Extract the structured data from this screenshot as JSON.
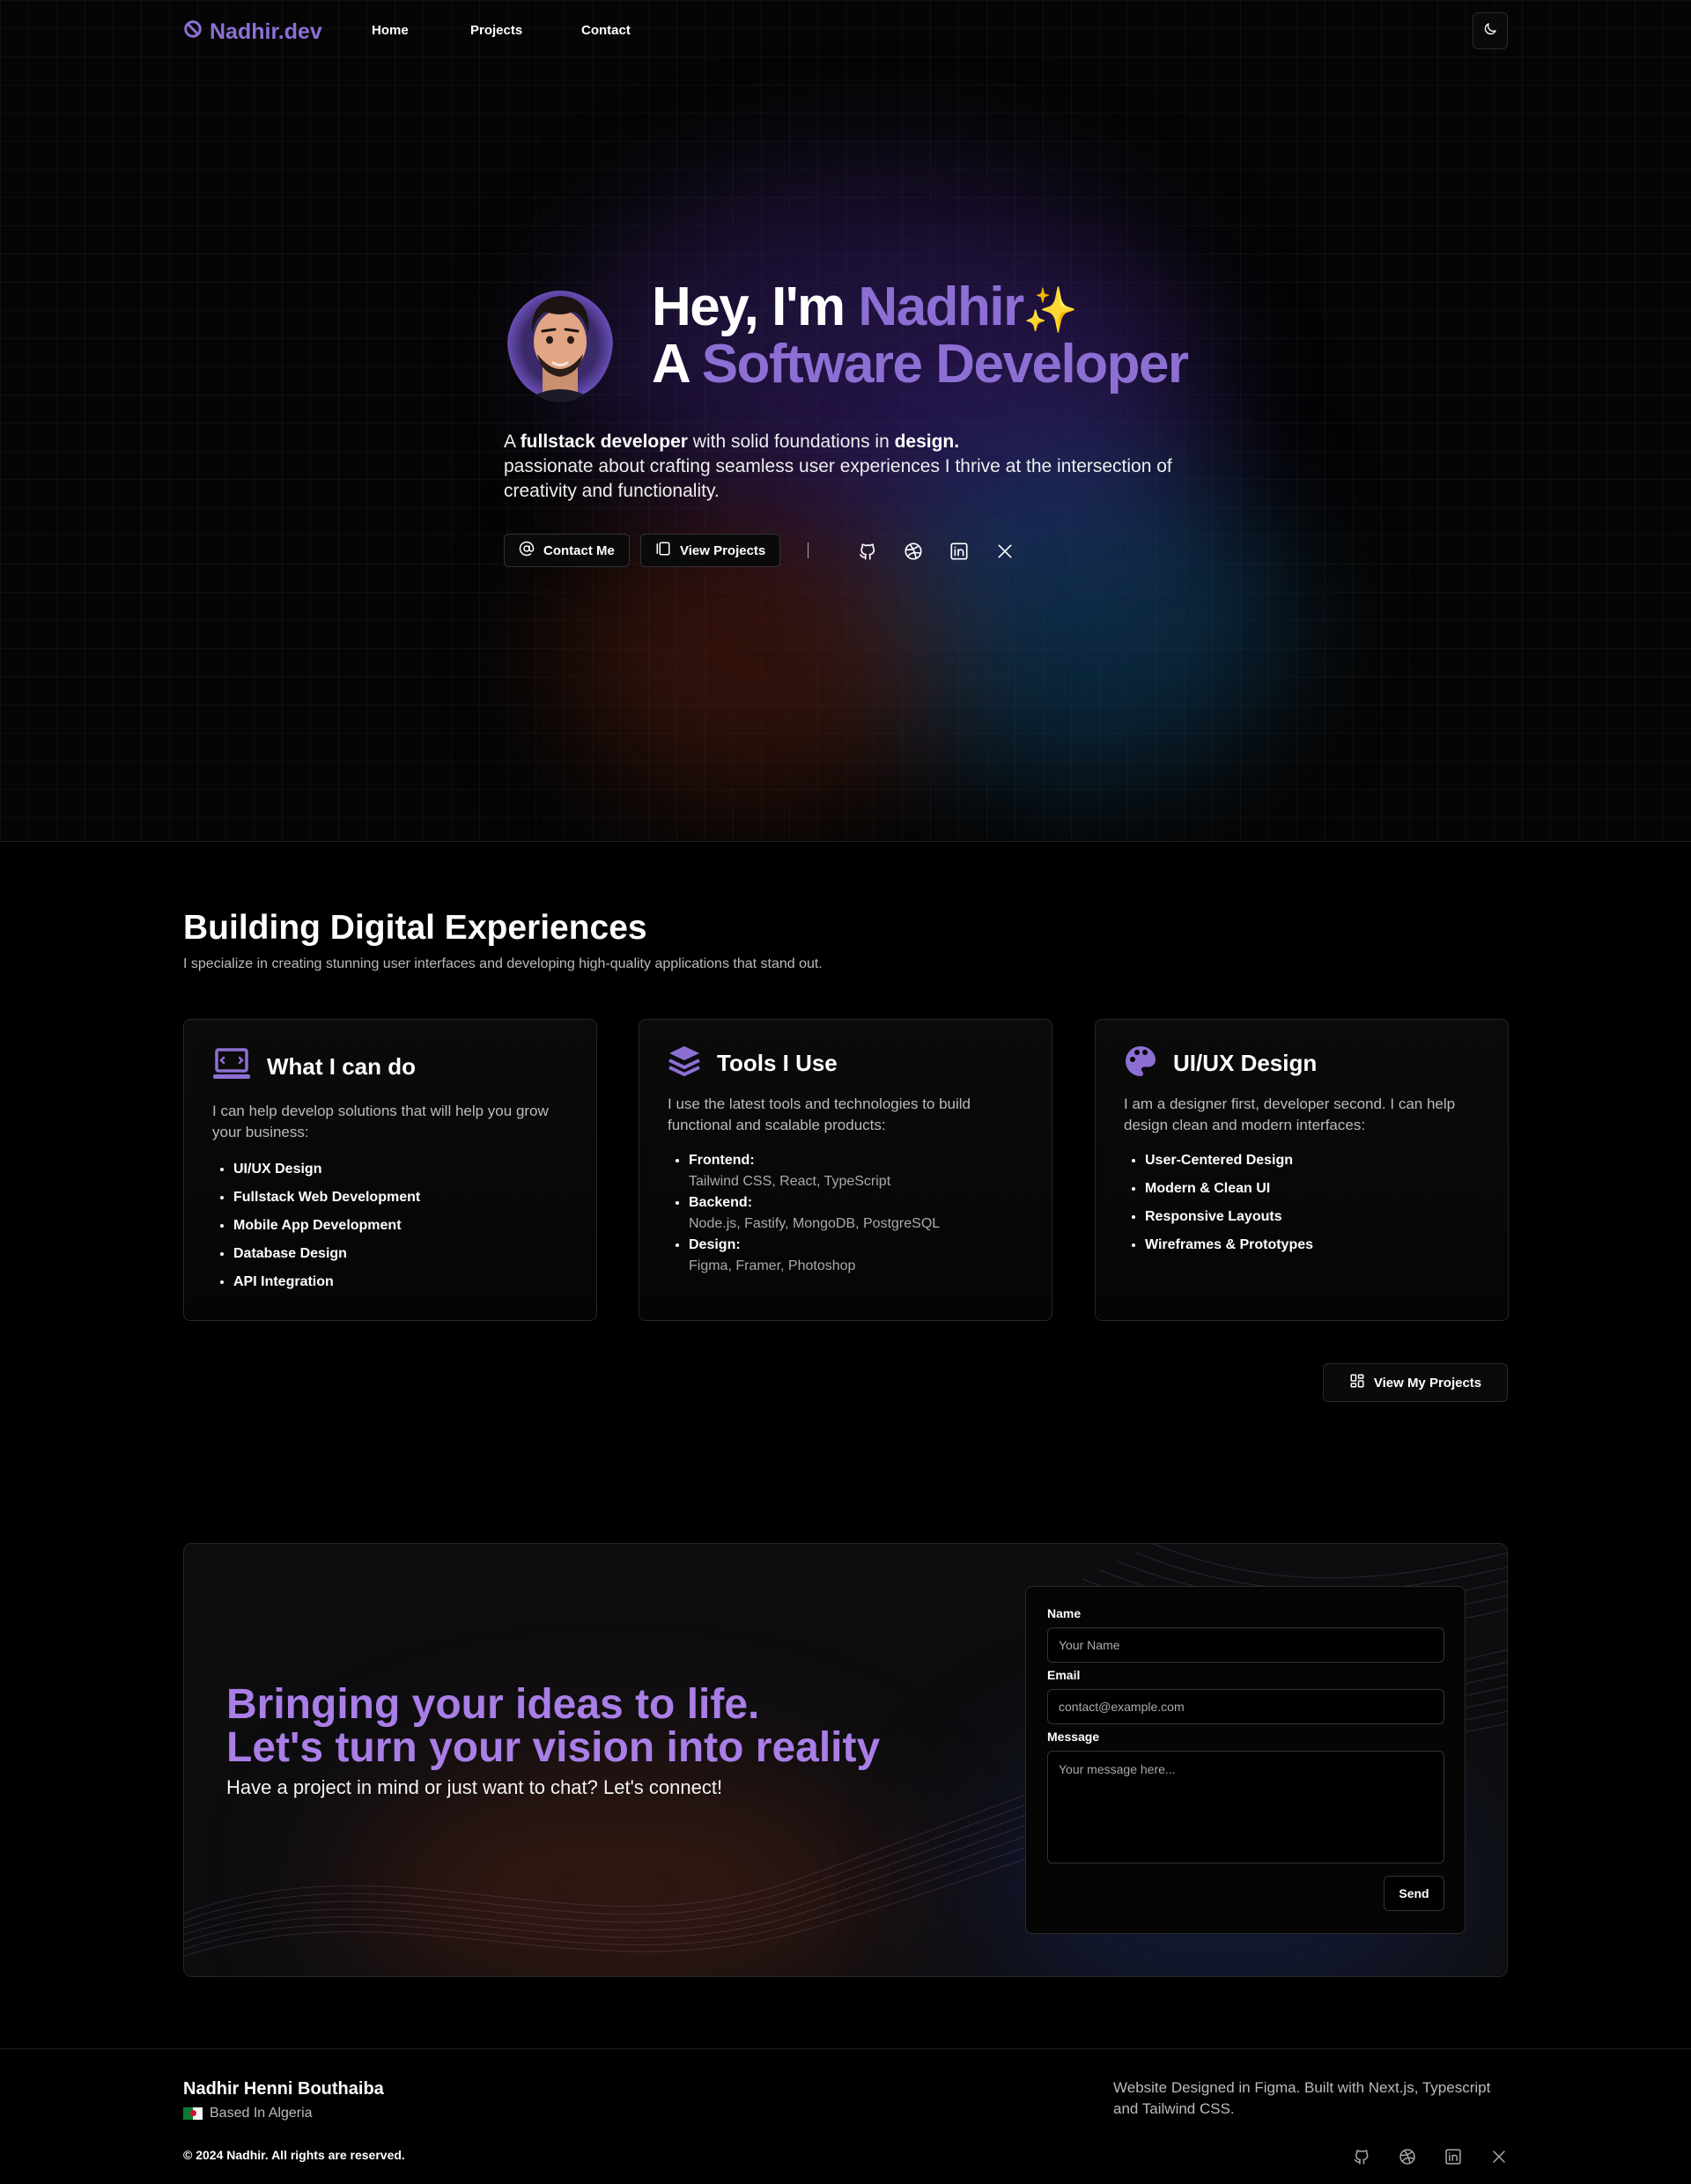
{
  "nav": {
    "logo": "Nadhir.dev",
    "home": "Home",
    "projects": "Projects",
    "contact": "Contact"
  },
  "hero": {
    "greeting_prefix": "Hey, I'm ",
    "name": "Nadhir",
    "sparkle": "✨",
    "role_prefix": "A ",
    "role": "Software Developer",
    "lead_a": "A ",
    "lead_fullstack": "fullstack developer",
    "lead_b": " with solid foundations in ",
    "lead_design": "design.",
    "lead_c": "passionate about crafting seamless user experiences I thrive at the intersection of creativity and functionality.",
    "contact_btn": "Contact Me",
    "projects_btn": "View Projects"
  },
  "about": {
    "title": "Building Digital Experiences",
    "subtitle": "I specialize in creating stunning user interfaces and developing high-quality applications that stand out.",
    "cards": [
      {
        "title": "What I can do",
        "icon": "laptop-icon",
        "desc": "I can help develop solutions that will help you grow your business:",
        "items": [
          "UI/UX Design",
          "Fullstack Web Development",
          "Mobile App Development",
          "Database Design",
          "API Integration"
        ]
      },
      {
        "title": "Tools I Use",
        "icon": "layers-icon",
        "desc": "I use the latest tools and technologies to build functional and scalable products:",
        "tools": [
          {
            "label": "Frontend:",
            "value": "Tailwind CSS, React, TypeScript"
          },
          {
            "label": "Backend:",
            "value": "Node.js, Fastify, MongoDB, PostgreSQL"
          },
          {
            "label": "Design:",
            "value": "Figma, Framer, Photoshop"
          }
        ]
      },
      {
        "title": "UI/UX Design",
        "icon": "palette-icon",
        "desc": "I am a designer first, developer second. I can help design clean and modern interfaces:",
        "items": [
          "User-Centered Design",
          "Modern & Clean UI",
          "Responsive Layouts",
          "Wireframes & Prototypes"
        ]
      }
    ],
    "view_projects": "View My Projects"
  },
  "contact": {
    "heading_1": "Bringing your ideas to life.",
    "heading_2": "Let's turn your vision into reality",
    "sub": "Have a project in mind or just want to chat? Let's connect!",
    "name_label": "Name",
    "name_placeholder": "Your Name",
    "email_label": "Email",
    "email_placeholder": "contact@example.com",
    "message_label": "Message",
    "message_placeholder": "Your message here...",
    "send": "Send"
  },
  "footer": {
    "name": "Nadhir Henni Bouthaiba",
    "location": "Based In Algeria",
    "copyright": "© 2024 Nadhir. All rights are reserved.",
    "built": "Website Designed in Figma. Built with Next.js, Typescript and Tailwind CSS."
  },
  "colors": {
    "accent": "#8d6fd4",
    "contact_heading": "#a97ee6",
    "background": "#000000"
  }
}
